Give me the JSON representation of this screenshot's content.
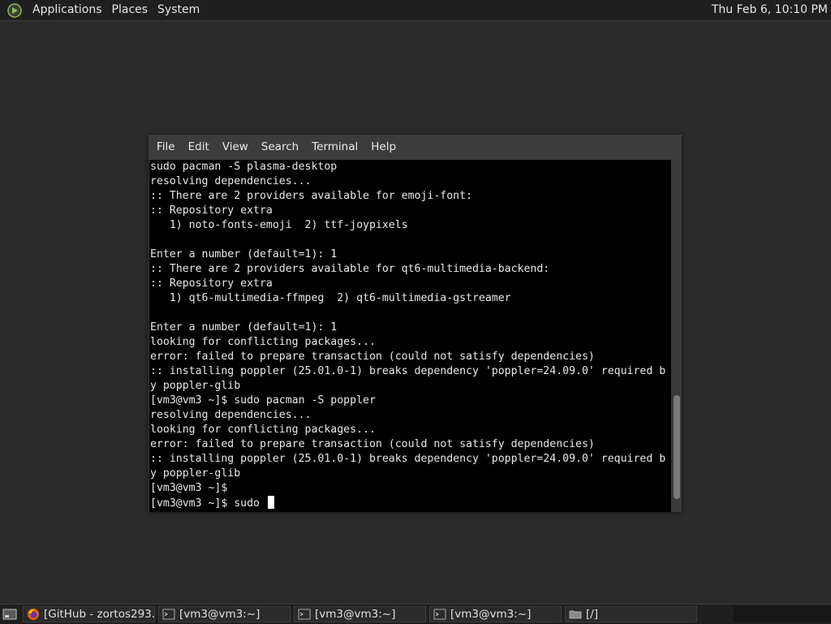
{
  "top_panel": {
    "menus": [
      "Applications",
      "Places",
      "System"
    ],
    "clock": "Thu Feb  6, 10:10 PM"
  },
  "terminal": {
    "menu": [
      "File",
      "Edit",
      "View",
      "Search",
      "Terminal",
      "Help"
    ],
    "lines": [
      "sudo pacman -S plasma-desktop",
      "resolving dependencies...",
      ":: There are 2 providers available for emoji-font:",
      ":: Repository extra",
      "   1) noto-fonts-emoji  2) ttf-joypixels",
      "",
      "Enter a number (default=1): 1",
      ":: There are 2 providers available for qt6-multimedia-backend:",
      ":: Repository extra",
      "   1) qt6-multimedia-ffmpeg  2) qt6-multimedia-gstreamer",
      "",
      "Enter a number (default=1): 1",
      "looking for conflicting packages...",
      "error: failed to prepare transaction (could not satisfy dependencies)",
      ":: installing poppler (25.01.0-1) breaks dependency 'poppler=24.09.0' required b",
      "y poppler-glib",
      "[vm3@vm3 ~]$ sudo pacman -S poppler",
      "resolving dependencies...",
      "looking for conflicting packages...",
      "error: failed to prepare transaction (could not satisfy dependencies)",
      ":: installing poppler (25.01.0-1) breaks dependency 'poppler=24.09.0' required b",
      "y poppler-glib",
      "[vm3@vm3 ~]$",
      "[vm3@vm3 ~]$ sudo "
    ]
  },
  "taskbar": {
    "tasks": [
      {
        "label": "[GitHub - zortos293...",
        "icon": "firefox-icon"
      },
      {
        "label": "[vm3@vm3:~]",
        "icon": "terminal-icon"
      },
      {
        "label": "[vm3@vm3:~]",
        "icon": "terminal-icon"
      },
      {
        "label": "[vm3@vm3:~]",
        "icon": "terminal-icon"
      },
      {
        "label": "[/]",
        "icon": "folder-icon"
      }
    ]
  }
}
